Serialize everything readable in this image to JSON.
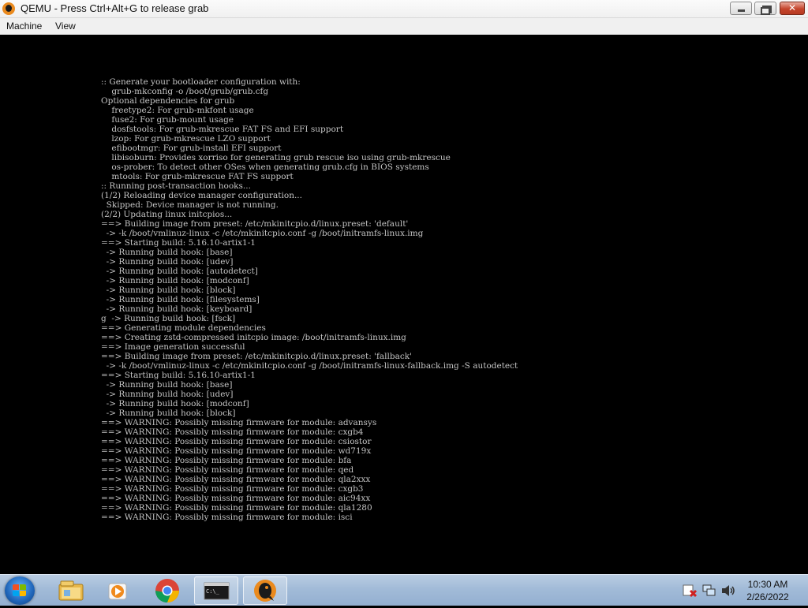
{
  "window": {
    "title": "QEMU - Press Ctrl+Alt+G to release grab",
    "minimize_icon": "minimize-icon",
    "maximize_icon": "restore-icon",
    "close_label": "✕"
  },
  "menu": {
    "items": [
      "Machine",
      "View"
    ]
  },
  "terminal": {
    "lines": [
      ":: Generate your bootloader configuration with:",
      "    grub-mkconfig -o /boot/grub/grub.cfg",
      "Optional dependencies for grub",
      "    freetype2: For grub-mkfont usage",
      "    fuse2: For grub-mount usage",
      "    dosfstools: For grub-mkrescue FAT FS and EFI support",
      "    lzop: For grub-mkrescue LZO support",
      "    efibootmgr: For grub-install EFI support",
      "    libisoburn: Provides xorriso for generating grub rescue iso using grub-mkrescue",
      "    os-prober: To detect other OSes when generating grub.cfg in BIOS systems",
      "    mtools: For grub-mkrescue FAT FS support",
      ":: Running post-transaction hooks...",
      "(1/2) Reloading device manager configuration...",
      "  Skipped: Device manager is not running.",
      "(2/2) Updating linux initcpios...",
      "==> Building image from preset: /etc/mkinitcpio.d/linux.preset: 'default'",
      "  -> -k /boot/vmlinuz-linux -c /etc/mkinitcpio.conf -g /boot/initramfs-linux.img",
      "==> Starting build: 5.16.10-artix1-1",
      "  -> Running build hook: [base]",
      "  -> Running build hook: [udev]",
      "  -> Running build hook: [autodetect]",
      "  -> Running build hook: [modconf]",
      "  -> Running build hook: [block]",
      "  -> Running build hook: [filesystems]",
      "  -> Running build hook: [keyboard]",
      "g  -> Running build hook: [fsck]",
      "==> Generating module dependencies",
      "==> Creating zstd-compressed initcpio image: /boot/initramfs-linux.img",
      "==> Image generation successful",
      "==> Building image from preset: /etc/mkinitcpio.d/linux.preset: 'fallback'",
      "  -> -k /boot/vmlinuz-linux -c /etc/mkinitcpio.conf -g /boot/initramfs-linux-fallback.img -S autodetect",
      "==> Starting build: 5.16.10-artix1-1",
      "  -> Running build hook: [base]",
      "  -> Running build hook: [udev]",
      "  -> Running build hook: [modconf]",
      "  -> Running build hook: [block]",
      "==> WARNING: Possibly missing firmware for module: advansys",
      "==> WARNING: Possibly missing firmware for module: cxgb4",
      "==> WARNING: Possibly missing firmware for module: csiostor",
      "==> WARNING: Possibly missing firmware for module: wd719x",
      "==> WARNING: Possibly missing firmware for module: bfa",
      "==> WARNING: Possibly missing firmware for module: qed",
      "==> WARNING: Possibly missing firmware for module: qla2xxx",
      "==> WARNING: Possibly missing firmware for module: cxgb3",
      "==> WARNING: Possibly missing firmware for module: aic94xx",
      "==> WARNING: Possibly missing firmware for module: qla1280",
      "==> WARNING: Possibly missing firmware for module: isci"
    ]
  },
  "taskbar": {
    "start_icon": "windows-start-icon",
    "buttons": [
      {
        "icon": "file-explorer-icon",
        "active": false
      },
      {
        "icon": "media-player-icon",
        "active": false
      },
      {
        "icon": "chrome-icon",
        "active": false
      },
      {
        "icon": "command-prompt-icon",
        "active": true
      },
      {
        "icon": "qemu-icon",
        "active": true
      }
    ],
    "tray_icons": [
      "action-center-icon",
      "network-icon",
      "volume-icon"
    ],
    "clock": {
      "time": "10:30 AM",
      "date": "2/26/2022"
    }
  },
  "colors": {
    "terminal_text": "#c4c4c4",
    "terminal_bg": "#000000",
    "taskbar": "#a2bbd8"
  }
}
